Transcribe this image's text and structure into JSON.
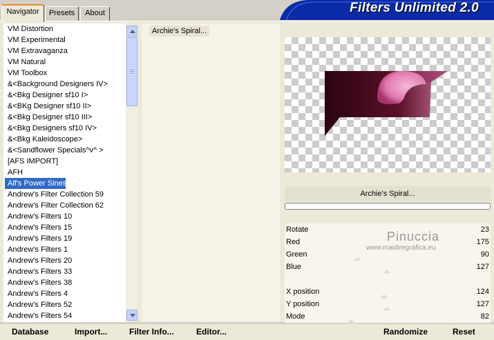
{
  "tabs": [
    {
      "label": "Navigator",
      "active": true
    },
    {
      "label": "Presets",
      "active": false
    },
    {
      "label": "About",
      "active": false
    }
  ],
  "app_title": "Filters Unlimited 2.0",
  "categories": [
    "VM Distortion",
    "VM Experimental",
    "VM Extravaganza",
    "VM Natural",
    "VM Toolbox",
    "&<Background Designers IV>",
    "&<Bkg Designer sf10 I>",
    "&<BKg Designer sf10 II>",
    "&<Bkg Designer sf10 III>",
    "&<Bkg Designers sf10 IV>",
    "&<Bkg Kaleidoscope>",
    "&<Sandflower Specials^v^ >",
    "[AFS IMPORT]",
    "AFH",
    "Alf's Power Sines",
    "Andrew's Filter Collection 59",
    "Andrew's Filter Collection 62",
    "Andrew's Filters 10",
    "Andrew's Filters 15",
    "Andrew's Filters 19",
    "Andrew's Filters 1",
    "Andrew's Filters 20",
    "Andrew's Filters 33",
    "Andrew's Filters 38",
    "Andrew's Filters 4",
    "Andrew's Filters 52",
    "Andrew's Filters 54"
  ],
  "selected_category": "Alf's Power Sines",
  "filters": [
    "Archie's Spiral..."
  ],
  "selected_filter_label": "Archie's Spiral...",
  "params": [
    {
      "label": "Rotate",
      "value": "23"
    },
    {
      "label": "Red",
      "value": "175"
    },
    {
      "label": "Green",
      "value": "90"
    },
    {
      "label": "Blue",
      "value": "127"
    },
    {
      "label": "",
      "value": ""
    },
    {
      "label": "X position",
      "value": "124"
    },
    {
      "label": "Y position",
      "value": "127"
    },
    {
      "label": "Mode",
      "value": "82"
    }
  ],
  "watermark": {
    "name": "Pinuccia",
    "url": "www.maidiregrafica.eu"
  },
  "buttons": {
    "database": "Database",
    "import": "Import...",
    "filter_info": "Filter Info...",
    "editor": "Editor...",
    "randomize": "Randomize",
    "reset": "Reset"
  },
  "colors": {
    "selection": "#316ac5",
    "title_banner": "#0a2aa8",
    "preview_dark": "#4a0a1e",
    "preview_pink": "#e68aba"
  }
}
